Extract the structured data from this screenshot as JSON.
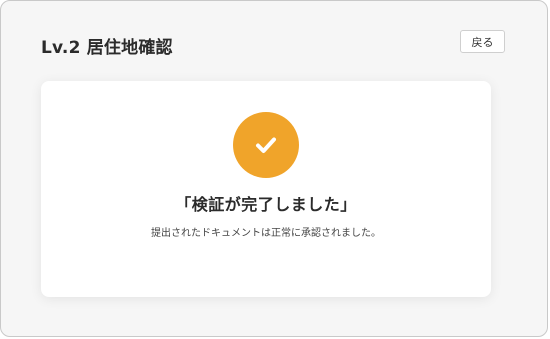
{
  "header": {
    "title": "Lv.2 居住地確認",
    "back_label": "戻る"
  },
  "result": {
    "icon": "check-icon",
    "icon_color": "#f0a42a",
    "title": "「検証が完了しました」",
    "message": "提出されたドキュメントは正常に承認されました。"
  }
}
